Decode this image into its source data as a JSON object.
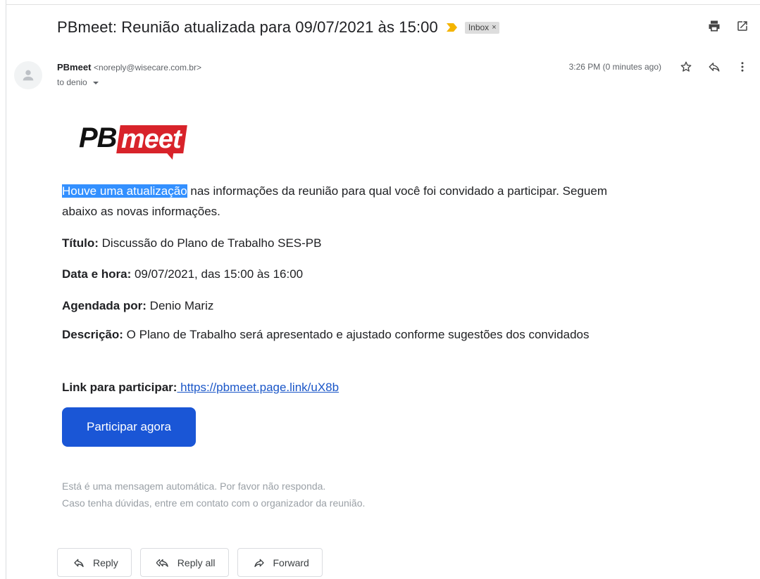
{
  "header": {
    "subject": "PBmeet: Reunião atualizada para 09/07/2021 às 15:00",
    "label": "Inbox",
    "label_remove": "×"
  },
  "sender": {
    "name": "PBmeet",
    "email": "<noreply@wisecare.com.br>",
    "to_text": "to denio",
    "timestamp": "3:26 PM (0 minutes ago)"
  },
  "logo": {
    "part1": "PB",
    "part2": "meet"
  },
  "message": {
    "intro_highlight": "Houve uma atualização",
    "intro_rest": " nas informações da reunião para qual você foi convidado a participar. Seguem abaixo as novas informações.",
    "title_label": "Título:",
    "title_value": " Discussão do Plano de Trabalho SES-PB",
    "date_label": "Data e hora:",
    "date_value": " 09/07/2021, das 15:00 às 16:00",
    "scheduled_label": "Agendada por:",
    "scheduled_value": " Denio Mariz",
    "desc_label": "Descrição:",
    "desc_value": " O Plano de Trabalho será apresentado e ajustado conforme sugestões dos convidados",
    "link_label": "Link para participar:",
    "link_value": " https://pbmeet.page.link/uX8b",
    "join_button": "Participar agora",
    "footer_line1": "Está é uma mensagem automática. Por favor não responda.",
    "footer_line2": "Caso tenha dúvidas, entre em contato com o organizador da reunião."
  },
  "actions": {
    "reply": "Reply",
    "reply_all": "Reply all",
    "forward": "Forward"
  },
  "colors": {
    "accent": "#1a56d6",
    "logo_red": "#d8232a",
    "highlight": "#3390ff",
    "importance": "#f4b400"
  }
}
